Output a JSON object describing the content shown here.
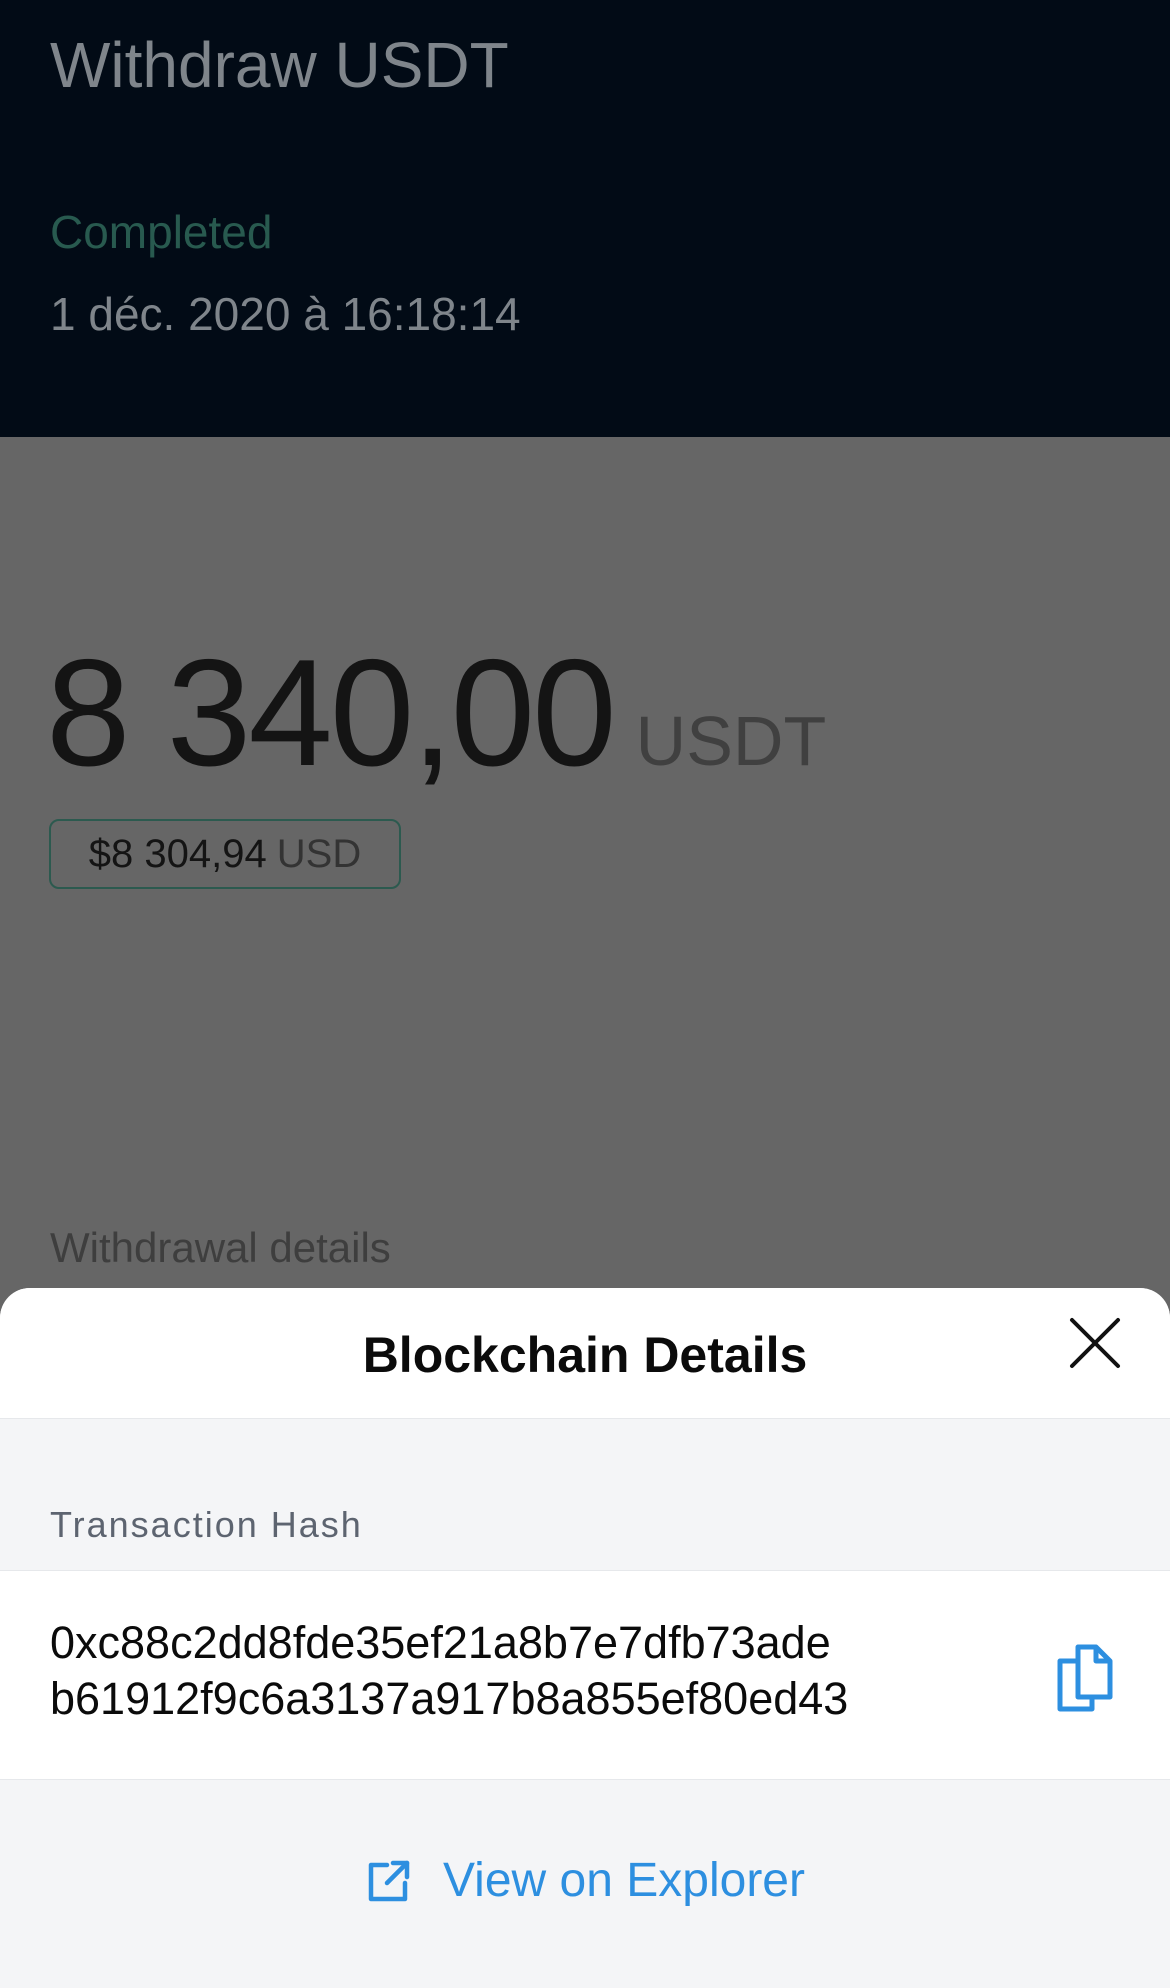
{
  "header": {
    "title": "Withdraw USDT",
    "status": "Completed",
    "timestamp": "1 déc. 2020 à 16:18:14"
  },
  "amount": {
    "value": "8 340,00",
    "unit": "USDT",
    "usd_value": "$8 304,94",
    "usd_unit": "USD"
  },
  "details": {
    "section_title": "Withdrawal details"
  },
  "sheet": {
    "title": "Blockchain Details",
    "hash_label": "Transaction Hash",
    "hash_lines": [
      "0xc88c2dd8fde35ef21a8b7e7dfb73ade",
      "b61912f9c6a3137a917b8a855ef80ed43"
    ],
    "explorer_label": "View on Explorer"
  },
  "icons": {
    "close": "close-icon",
    "copy": "copy-icon",
    "external_link": "external-link-icon"
  },
  "colors": {
    "header_bg": "#020b16",
    "overlay_bg": "#666666",
    "status_green": "#285a4f",
    "link_blue": "#2d8fe0",
    "sheet_bg": "#f4f5f7"
  }
}
